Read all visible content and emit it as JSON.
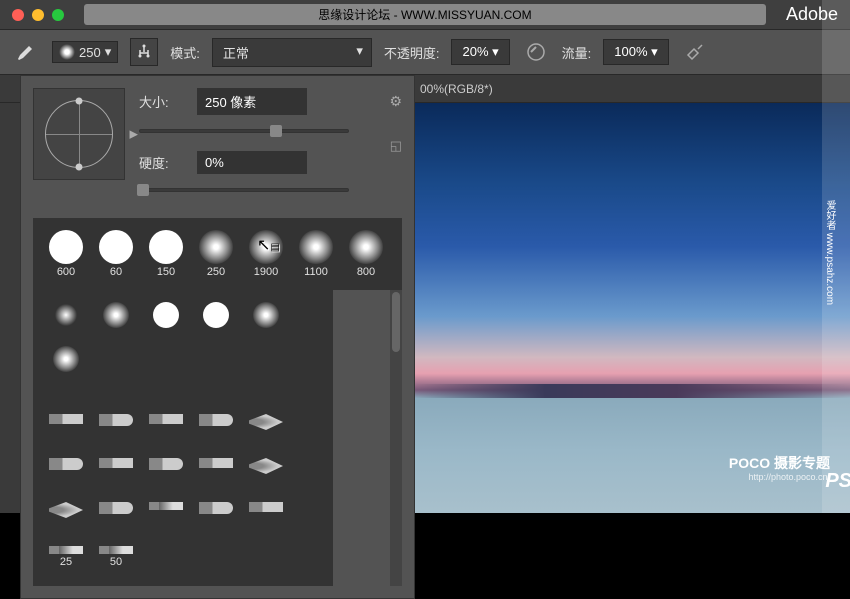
{
  "titlebar": {
    "forum_text": "思缘设计论坛 - WWW.MISSYUAN.COM",
    "app_name": "Adobe"
  },
  "options": {
    "brush_size": "250",
    "mode_label": "模式:",
    "mode_value": "正常",
    "opacity_label": "不透明度:",
    "opacity_value": "20%",
    "flow_label": "流量:",
    "flow_value": "100%"
  },
  "tab": {
    "doc_title": "00%(RGB/8*)"
  },
  "brush_panel": {
    "size_label": "大小:",
    "size_value": "250 像素",
    "hardness_label": "硬度:",
    "hardness_value": "0%",
    "presets_row1": [
      {
        "size": "600",
        "type": "solid"
      },
      {
        "size": "60",
        "type": "solid"
      },
      {
        "size": "150",
        "type": "solid"
      },
      {
        "size": "250",
        "type": "soft"
      },
      {
        "size": "1900",
        "type": "soft"
      },
      {
        "size": "1100",
        "type": "soft"
      },
      {
        "size": "800",
        "type": "soft"
      }
    ],
    "presets_row2": [
      {
        "type": "soft-small"
      },
      {
        "type": "soft"
      },
      {
        "type": "solid"
      },
      {
        "type": "solid"
      },
      {
        "type": "soft"
      },
      {
        "type": "soft"
      }
    ],
    "special_rows": [
      [
        "sb-flat",
        "sb-round",
        "sb-flat",
        "sb-round",
        "sb-fan",
        "sb-round"
      ],
      [
        "sb-flat",
        "sb-round",
        "sb-flat",
        "sb-fan",
        "sb-fan",
        "sb-round"
      ],
      [
        "sb-pencil",
        "sb-round",
        "sb-flat",
        "sb-pencil",
        "sb-pencil",
        ""
      ]
    ],
    "special_labels": [
      "",
      "",
      "",
      "25",
      "50",
      ""
    ]
  },
  "watermarks": {
    "poco": "POCO 摄影专题",
    "poco_url": "http://photo.poco.cn/",
    "ps_logo": "PS",
    "side_text": "爱好者\nwww.psahz.com"
  },
  "colors": {
    "panel_bg": "#535353",
    "dark_bg": "#3a3a3a"
  }
}
